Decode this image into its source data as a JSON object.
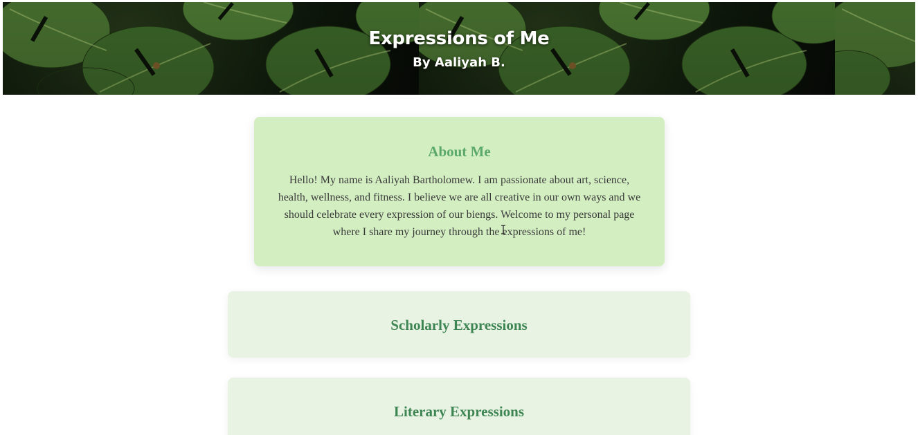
{
  "header": {
    "title": "Expressions of Me",
    "subtitle": "By Aaliyah B."
  },
  "about": {
    "heading": "About Me",
    "body": "Hello! My name is Aaliyah Bartholomew. I am passionate about art, science, health, wellness, and fitness. I believe we are all creative in our own ways and we should celebrate every expression of our biengs. Welcome to my personal page where I share my journey through the expressions of me!"
  },
  "sections": [
    {
      "heading": "Scholarly Expressions"
    },
    {
      "heading": "Literary Expressions"
    }
  ],
  "colors": {
    "about_background": "#d3efc2",
    "about_heading": "#5aa86a",
    "section_background": "#e9f3e4",
    "section_heading": "#3d8553",
    "body_text": "#3a3a3a"
  }
}
